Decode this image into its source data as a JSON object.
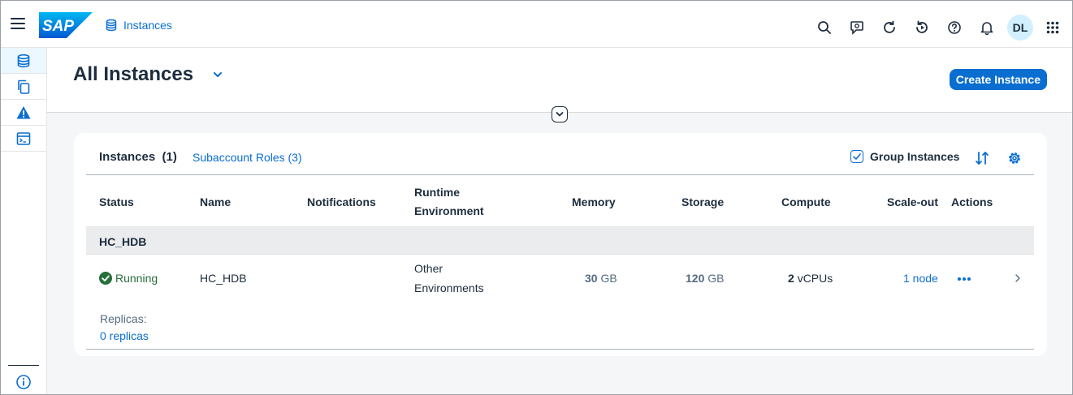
{
  "shell": {
    "logo_text": "SAP",
    "app_title": "Instances",
    "avatar_initials": "DL",
    "icons": [
      "search-icon",
      "feedback-icon",
      "refresh-icon",
      "history-icon",
      "help-icon",
      "bell-icon",
      "grid-icon"
    ]
  },
  "page": {
    "title": "All Instances",
    "create_button": "Create Instance"
  },
  "toolbar": {
    "title": "Instances",
    "count": "(1)",
    "roles_link": "Subaccount Roles (3)",
    "group_label": "Group Instances",
    "group_checked": true
  },
  "table": {
    "headers": {
      "status": "Status",
      "name": "Name",
      "notifications": "Notifications",
      "runtime_line1": "Runtime",
      "runtime_line2": "Environment",
      "memory": "Memory",
      "storage": "Storage",
      "compute": "Compute",
      "scaleout": "Scale-out",
      "actions": "Actions"
    },
    "group": "HC_HDB",
    "row": {
      "status": "Running",
      "name": "HC_HDB",
      "runtime_line1": "Other",
      "runtime_line2": "Environments",
      "memory_value": "30",
      "memory_unit": "GB",
      "storage_value": "120",
      "storage_unit": "GB",
      "compute_value": "2",
      "compute_unit": "vCPUs",
      "scaleout": "1 node",
      "replicas_label": "Replicas:",
      "replicas_link": "0 replicas"
    }
  },
  "colors": {
    "accent": "#0a6ed1",
    "success": "#256f3a",
    "avatar_bg": "#d1efff"
  }
}
